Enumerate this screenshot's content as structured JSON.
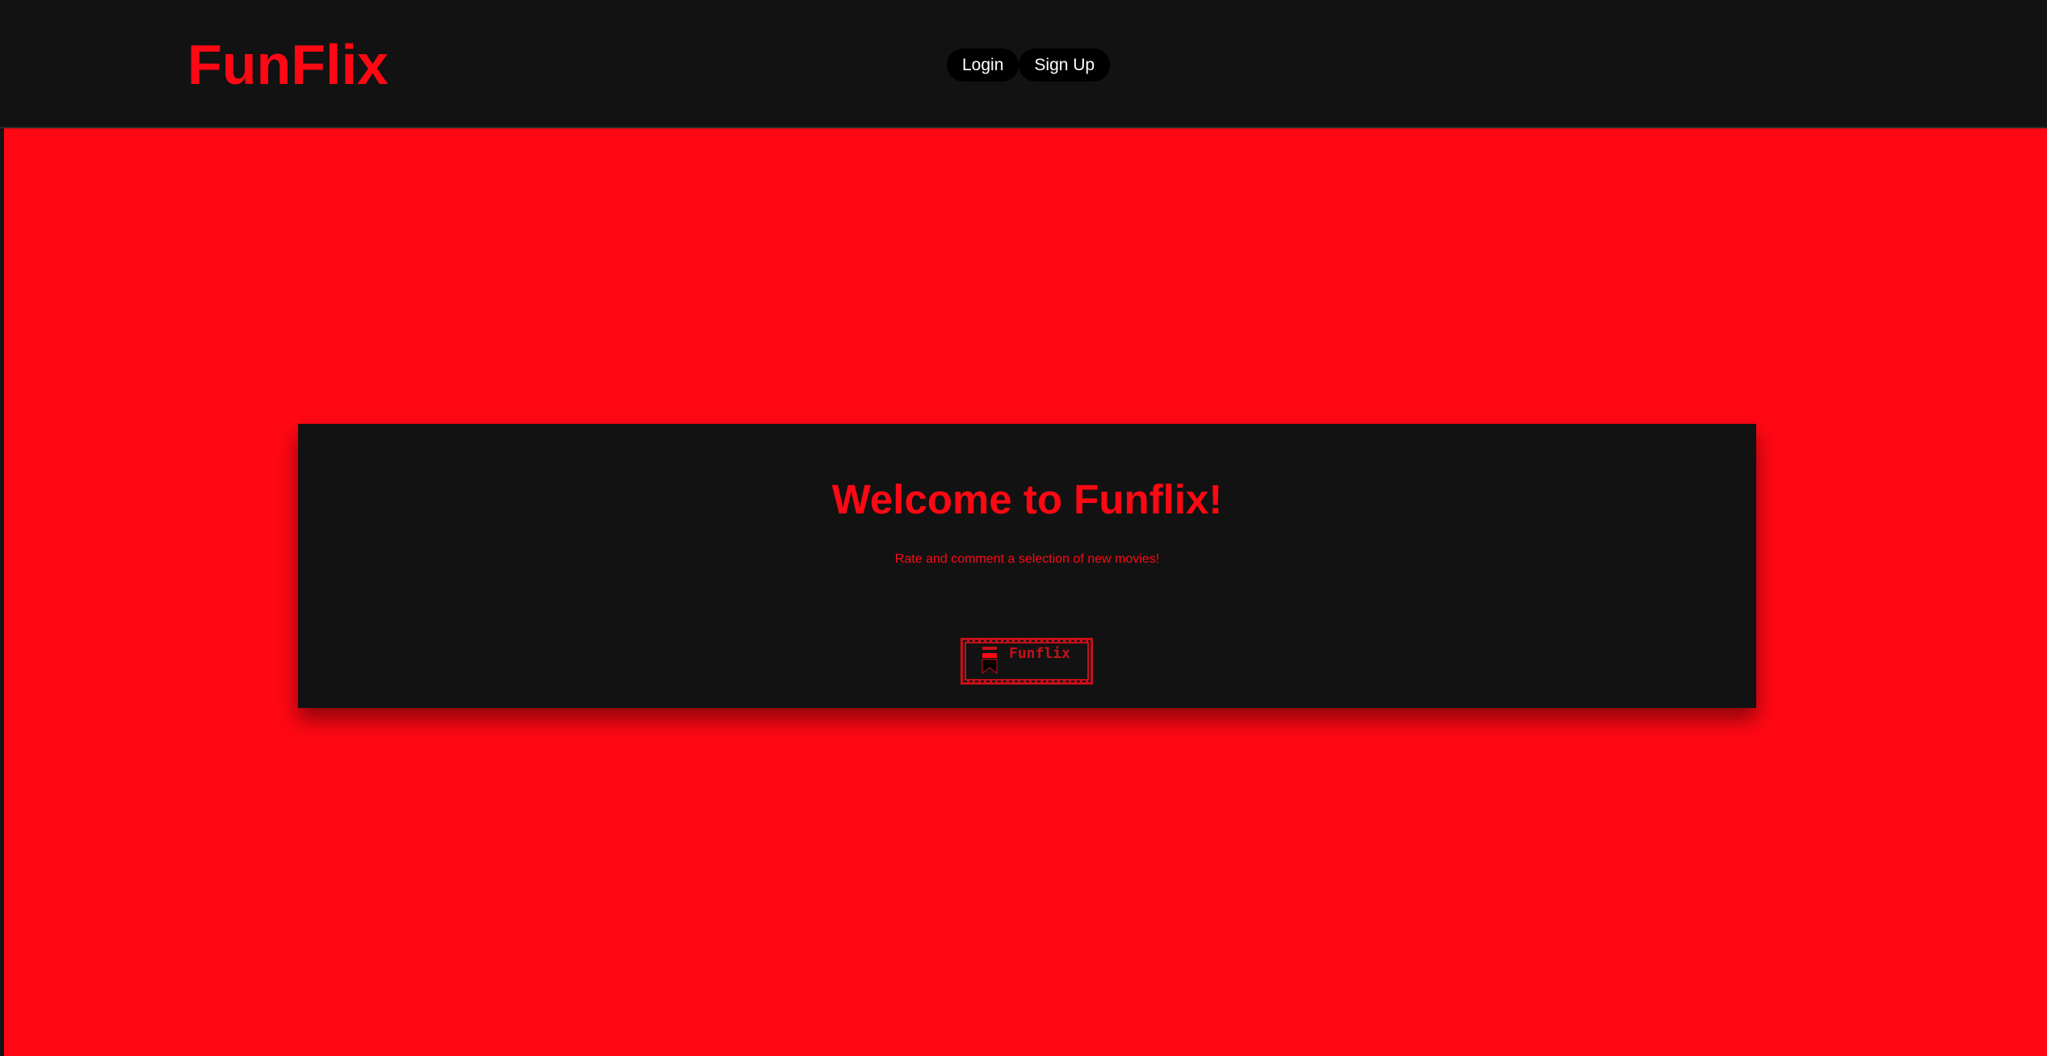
{
  "navbar": {
    "brand": "FunFlix",
    "login_label": "Login",
    "signup_label": "Sign Up"
  },
  "hero": {
    "title": "Welcome to Funflix!",
    "subtitle": "Rate and comment a selection of new movies!",
    "logo_icon": "funflix-film-strip-logo",
    "logo_text": "Funflix"
  },
  "colors": {
    "accent": "#ff0814",
    "dark": "#121212",
    "button_bg": "#000000",
    "button_text": "#ffffff"
  }
}
